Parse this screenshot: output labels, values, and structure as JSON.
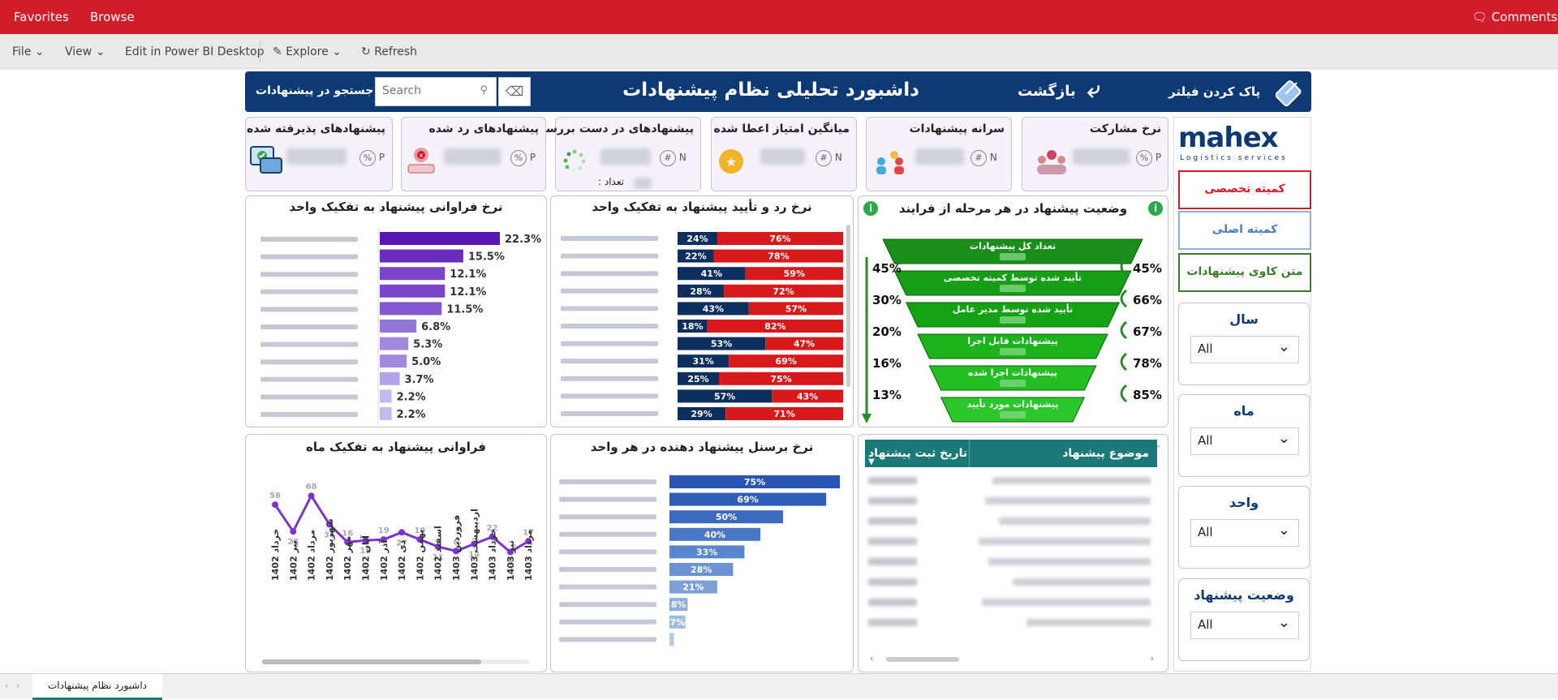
{
  "topbar": {
    "favorites": "Favorites",
    "browse": "Browse",
    "comments": "Comments"
  },
  "menu": {
    "file": "File",
    "view": "View",
    "edit": "Edit in Power BI Desktop",
    "explore": "Explore",
    "refresh": "Refresh"
  },
  "header": {
    "title": "داشبورد تحلیلی نظام پیشنهادات",
    "back": "بازگشت",
    "clear_filter": "پاک کردن فیلتر",
    "search_label": "جستجو در پیشنهادات",
    "search_placeholder": "Search"
  },
  "kpis": [
    {
      "title": "نرخ مشارکت",
      "badge": "P",
      "unit": "%"
    },
    {
      "title": "سرانه پیشنهادات",
      "badge": "N",
      "unit": "#"
    },
    {
      "title": "میانگین امتیاز اعطا شده",
      "badge": "N",
      "unit": "#"
    },
    {
      "title": "پیشنهادهای در دست بررسی",
      "badge": "N",
      "unit": "#",
      "count_label": "تعداد :"
    },
    {
      "title": "پیشنهادهای رد شده",
      "badge": "P",
      "unit": "%"
    },
    {
      "title": "پیشنهادهای پذیرفته شده",
      "badge": "P",
      "unit": "%"
    }
  ],
  "sidebar": {
    "logo_main": "mahex",
    "logo_sub": "Logistics services",
    "buttons": [
      "کمیته تخصصی",
      "کمیته اصلی",
      "متن کاوی پیشنهادات"
    ],
    "slicers": [
      {
        "title": "سال",
        "value": "All"
      },
      {
        "title": "ماه",
        "value": "All"
      },
      {
        "title": "واحد",
        "value": "All"
      },
      {
        "title": "وضعیت پیشنهاد",
        "value": "All"
      }
    ]
  },
  "colors": {
    "header": "#0d3a73",
    "topbar": "#d11d2a",
    "purple": "#6a2cbf",
    "reject": "#d7191c",
    "accept": "#0d2f5e",
    "funnel": "#1e9e1e",
    "bluebar": "#2f5eb8"
  },
  "chart_data": [
    {
      "type": "bar",
      "title": "نرخ فراوانی پیشنهاد به تفکیک واحد",
      "values": [
        22.3,
        15.5,
        12.1,
        12.1,
        11.5,
        6.8,
        5.3,
        5.0,
        3.7,
        2.2,
        2.2
      ],
      "labels": [
        "22.3%",
        "15.5%",
        "12.1%",
        "12.1%",
        "11.5%",
        "6.8%",
        "5.3%",
        "5.0%",
        "3.7%",
        "2.2%",
        "2.2%"
      ]
    },
    {
      "type": "bar",
      "title": "نرخ رد و تأیید پیشنهاد به تفکیک واحد",
      "accept": [
        24,
        22,
        41,
        28,
        43,
        18,
        53,
        31,
        25,
        57,
        29
      ],
      "reject": [
        76,
        78,
        59,
        72,
        57,
        82,
        47,
        69,
        75,
        43,
        71
      ]
    },
    {
      "type": "bar",
      "title": "وضعیت پیشنهاد در هر مرحله از فرایند",
      "stages": [
        "تعداد کل پیشنهادات",
        "تأیید شده توسط کمیته تخصصی",
        "تأیید شده توسط مدیر عامل",
        "پیشنهادات قابل اجرا",
        "پیشنهادات اجرا شده",
        "پیشنهادات مورد تأیید"
      ],
      "left_pct": [
        "45%",
        "30%",
        "20%",
        "16%",
        "13%"
      ],
      "right_pct": [
        "45%",
        "66%",
        "67%",
        "78%",
        "85%"
      ]
    },
    {
      "type": "line",
      "title": "فراوانی پیشنهاد به تفکیک ماه",
      "categories": [
        "خرداد 1402",
        "تیر 1402",
        "مرداد 1402",
        "شهریور 1402",
        "مهر 1402",
        "آبان 1402",
        "آذر 1402",
        "دی 1402",
        "بهمن 1402",
        "اسفند 1402",
        "فروردین 1403",
        "اردیبهشت 1403",
        "خرداد 1403",
        "تیر 1403",
        "مرداد 1403"
      ],
      "values": [
        58,
        28,
        68,
        36,
        16,
        18,
        19,
        27,
        19,
        11,
        6,
        14,
        22,
        5,
        17
      ]
    },
    {
      "type": "bar",
      "title": "نرخ برسنل پیشنهاد دهنده در هر واحد",
      "values": [
        75,
        69,
        50,
        40,
        33,
        28,
        21,
        8,
        7,
        2
      ],
      "labels": [
        "75%",
        "69%",
        "50%",
        "40%",
        "33%",
        "28%",
        "21%",
        "8%",
        "7%",
        ""
      ]
    }
  ],
  "table": {
    "col1": "موضوع پیشنهاد",
    "col2": "تاریخ ثبت پیشنهاد"
  },
  "footer": {
    "page_tab": "داشبورد نظام پیشنهادات"
  }
}
